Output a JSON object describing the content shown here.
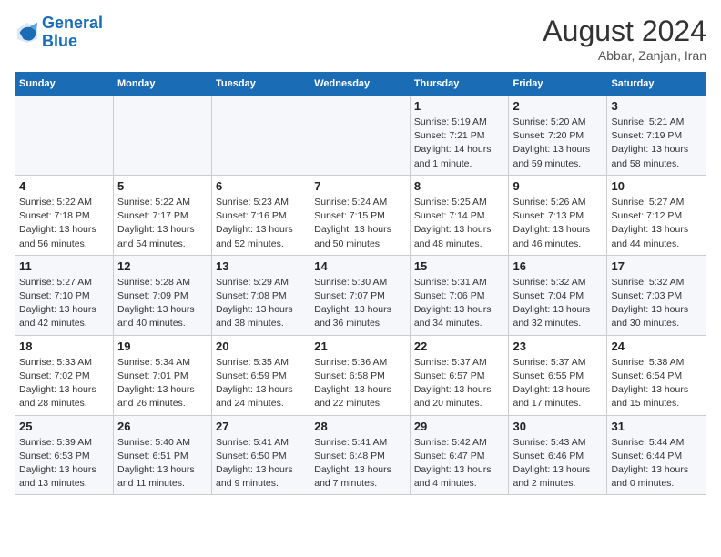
{
  "header": {
    "logo_line1": "General",
    "logo_line2": "Blue",
    "month_year": "August 2024",
    "location": "Abbar, Zanjan, Iran"
  },
  "weekdays": [
    "Sunday",
    "Monday",
    "Tuesday",
    "Wednesday",
    "Thursday",
    "Friday",
    "Saturday"
  ],
  "weeks": [
    [
      {
        "day": "",
        "info": ""
      },
      {
        "day": "",
        "info": ""
      },
      {
        "day": "",
        "info": ""
      },
      {
        "day": "",
        "info": ""
      },
      {
        "day": "1",
        "info": "Sunrise: 5:19 AM\nSunset: 7:21 PM\nDaylight: 14 hours\nand 1 minute."
      },
      {
        "day": "2",
        "info": "Sunrise: 5:20 AM\nSunset: 7:20 PM\nDaylight: 13 hours\nand 59 minutes."
      },
      {
        "day": "3",
        "info": "Sunrise: 5:21 AM\nSunset: 7:19 PM\nDaylight: 13 hours\nand 58 minutes."
      }
    ],
    [
      {
        "day": "4",
        "info": "Sunrise: 5:22 AM\nSunset: 7:18 PM\nDaylight: 13 hours\nand 56 minutes."
      },
      {
        "day": "5",
        "info": "Sunrise: 5:22 AM\nSunset: 7:17 PM\nDaylight: 13 hours\nand 54 minutes."
      },
      {
        "day": "6",
        "info": "Sunrise: 5:23 AM\nSunset: 7:16 PM\nDaylight: 13 hours\nand 52 minutes."
      },
      {
        "day": "7",
        "info": "Sunrise: 5:24 AM\nSunset: 7:15 PM\nDaylight: 13 hours\nand 50 minutes."
      },
      {
        "day": "8",
        "info": "Sunrise: 5:25 AM\nSunset: 7:14 PM\nDaylight: 13 hours\nand 48 minutes."
      },
      {
        "day": "9",
        "info": "Sunrise: 5:26 AM\nSunset: 7:13 PM\nDaylight: 13 hours\nand 46 minutes."
      },
      {
        "day": "10",
        "info": "Sunrise: 5:27 AM\nSunset: 7:12 PM\nDaylight: 13 hours\nand 44 minutes."
      }
    ],
    [
      {
        "day": "11",
        "info": "Sunrise: 5:27 AM\nSunset: 7:10 PM\nDaylight: 13 hours\nand 42 minutes."
      },
      {
        "day": "12",
        "info": "Sunrise: 5:28 AM\nSunset: 7:09 PM\nDaylight: 13 hours\nand 40 minutes."
      },
      {
        "day": "13",
        "info": "Sunrise: 5:29 AM\nSunset: 7:08 PM\nDaylight: 13 hours\nand 38 minutes."
      },
      {
        "day": "14",
        "info": "Sunrise: 5:30 AM\nSunset: 7:07 PM\nDaylight: 13 hours\nand 36 minutes."
      },
      {
        "day": "15",
        "info": "Sunrise: 5:31 AM\nSunset: 7:06 PM\nDaylight: 13 hours\nand 34 minutes."
      },
      {
        "day": "16",
        "info": "Sunrise: 5:32 AM\nSunset: 7:04 PM\nDaylight: 13 hours\nand 32 minutes."
      },
      {
        "day": "17",
        "info": "Sunrise: 5:32 AM\nSunset: 7:03 PM\nDaylight: 13 hours\nand 30 minutes."
      }
    ],
    [
      {
        "day": "18",
        "info": "Sunrise: 5:33 AM\nSunset: 7:02 PM\nDaylight: 13 hours\nand 28 minutes."
      },
      {
        "day": "19",
        "info": "Sunrise: 5:34 AM\nSunset: 7:01 PM\nDaylight: 13 hours\nand 26 minutes."
      },
      {
        "day": "20",
        "info": "Sunrise: 5:35 AM\nSunset: 6:59 PM\nDaylight: 13 hours\nand 24 minutes."
      },
      {
        "day": "21",
        "info": "Sunrise: 5:36 AM\nSunset: 6:58 PM\nDaylight: 13 hours\nand 22 minutes."
      },
      {
        "day": "22",
        "info": "Sunrise: 5:37 AM\nSunset: 6:57 PM\nDaylight: 13 hours\nand 20 minutes."
      },
      {
        "day": "23",
        "info": "Sunrise: 5:37 AM\nSunset: 6:55 PM\nDaylight: 13 hours\nand 17 minutes."
      },
      {
        "day": "24",
        "info": "Sunrise: 5:38 AM\nSunset: 6:54 PM\nDaylight: 13 hours\nand 15 minutes."
      }
    ],
    [
      {
        "day": "25",
        "info": "Sunrise: 5:39 AM\nSunset: 6:53 PM\nDaylight: 13 hours\nand 13 minutes."
      },
      {
        "day": "26",
        "info": "Sunrise: 5:40 AM\nSunset: 6:51 PM\nDaylight: 13 hours\nand 11 minutes."
      },
      {
        "day": "27",
        "info": "Sunrise: 5:41 AM\nSunset: 6:50 PM\nDaylight: 13 hours\nand 9 minutes."
      },
      {
        "day": "28",
        "info": "Sunrise: 5:41 AM\nSunset: 6:48 PM\nDaylight: 13 hours\nand 7 minutes."
      },
      {
        "day": "29",
        "info": "Sunrise: 5:42 AM\nSunset: 6:47 PM\nDaylight: 13 hours\nand 4 minutes."
      },
      {
        "day": "30",
        "info": "Sunrise: 5:43 AM\nSunset: 6:46 PM\nDaylight: 13 hours\nand 2 minutes."
      },
      {
        "day": "31",
        "info": "Sunrise: 5:44 AM\nSunset: 6:44 PM\nDaylight: 13 hours\nand 0 minutes."
      }
    ]
  ]
}
